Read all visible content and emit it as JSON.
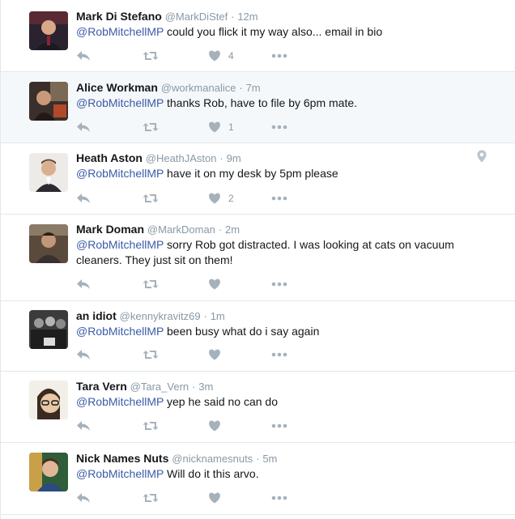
{
  "tweets": [
    {
      "name": "Mark Di Stefano",
      "handle": "@MarkDiStef",
      "sep": "·",
      "time": "12m",
      "mention": "@RobMitchellMP",
      "text": " could you flick it my way also... email in bio",
      "likes": "4",
      "avatar_color": "#2b2230",
      "highlighted": false,
      "geo": false
    },
    {
      "name": "Alice Workman",
      "handle": "@workmanalice",
      "sep": "·",
      "time": "7m",
      "mention": "@RobMitchellMP",
      "text": " thanks Rob, have to file by 6pm mate.",
      "likes": "1",
      "avatar_color": "#3a2f2a",
      "highlighted": true,
      "geo": false
    },
    {
      "name": "Heath Aston",
      "handle": "@HeathJAston",
      "sep": "·",
      "time": "9m",
      "mention": "@RobMitchellMP",
      "text": " have it on my desk by 5pm please",
      "likes": "2",
      "avatar_color": "#e9e6e2",
      "highlighted": false,
      "geo": true
    },
    {
      "name": "Mark Doman",
      "handle": "@MarkDoman",
      "sep": "·",
      "time": "2m",
      "mention": "@RobMitchellMP",
      "text": " sorry Rob got distracted. I was looking at cats on vacuum cleaners. They just sit on them!",
      "likes": "",
      "avatar_color": "#5a4a3c",
      "highlighted": false,
      "geo": false
    },
    {
      "name": "an idiot",
      "handle": "@kennykravitz69",
      "sep": "·",
      "time": "1m",
      "mention": "@RobMitchellMP",
      "text": " been busy what do i say again",
      "likes": "",
      "avatar_color": "#3b3b3b",
      "highlighted": false,
      "geo": false
    },
    {
      "name": "Tara Vern",
      "handle": "@Tara_Vern",
      "sep": "·",
      "time": "3m",
      "mention": "@RobMitchellMP",
      "text": " yep he said no can do",
      "likes": "",
      "avatar_color": "#e8d2b8",
      "highlighted": false,
      "geo": false
    },
    {
      "name": "Nick Names Nuts",
      "handle": "@nicknamesnuts",
      "sep": "·",
      "time": "5m",
      "mention": "@RobMitchellMP",
      "text": " Will do it this arvo.",
      "likes": "",
      "avatar_color": "#2f5d3a",
      "highlighted": false,
      "geo": false
    }
  ],
  "icons": {
    "reply": "reply-icon",
    "retweet": "retweet-icon",
    "like": "heart-icon",
    "more": "more-icon",
    "location": "location-pin-icon"
  },
  "colors": {
    "mention": "#3b5ba8",
    "muted": "#8899a6",
    "icon": "#a5b1bb",
    "highlight_bg": "#f5f8fa"
  }
}
